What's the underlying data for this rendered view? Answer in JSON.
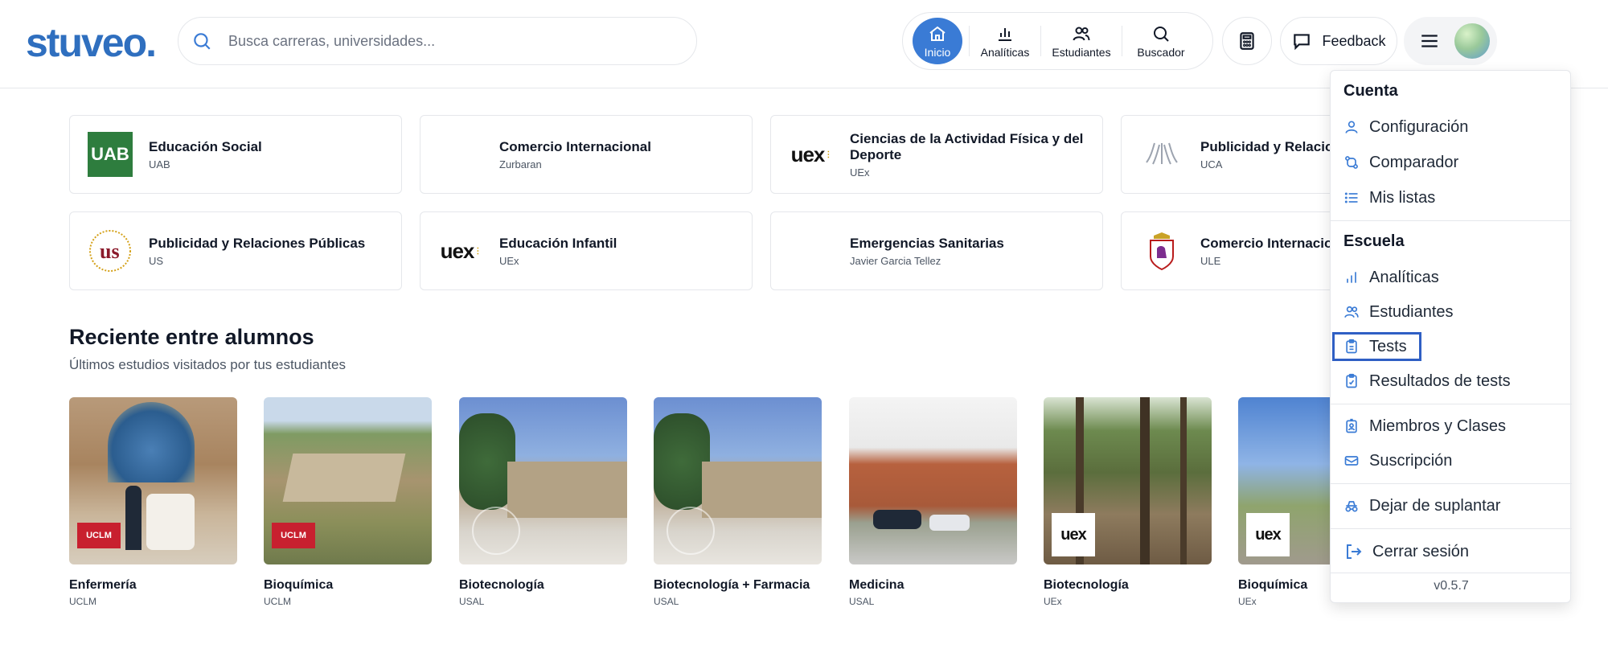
{
  "header": {
    "logo": "stuveo.",
    "search_placeholder": "Busca carreras, universidades...",
    "nav": {
      "inicio": "Inicio",
      "analiticas": "Analíticas",
      "estudiantes": "Estudiantes",
      "buscador": "Buscador"
    },
    "feedback_label": "Feedback"
  },
  "cards": [
    {
      "title": "Educación Social",
      "sub": "UAB",
      "logo": "UAB"
    },
    {
      "title": "Comercio Internacional",
      "sub": "Zurbaran",
      "logo": ""
    },
    {
      "title": "Ciencias de la Actividad Física y del Deporte",
      "sub": "UEx",
      "logo": "uex"
    },
    {
      "title": "Publicidad y Relacio",
      "sub": "UCA",
      "logo": "uca"
    },
    {
      "title": "Publicidad y Relaciones Públicas",
      "sub": "US",
      "logo": "us"
    },
    {
      "title": "Educación Infantil",
      "sub": "UEx",
      "logo": "uex"
    },
    {
      "title": "Emergencias Sanitarias",
      "sub": "Javier Garcia Tellez",
      "logo": ""
    },
    {
      "title": "Comercio Internacio",
      "sub": "ULE",
      "logo": "ule"
    }
  ],
  "section": {
    "title": "Reciente entre alumnos",
    "subtitle": "Últimos estudios visitados por tus estudiantes"
  },
  "tiles": [
    {
      "title": "Enfermería",
      "sub": "UCLM",
      "badge": "UCLM"
    },
    {
      "title": "Bioquímica",
      "sub": "UCLM",
      "badge": "UCLM"
    },
    {
      "title": "Biotecnología",
      "sub": "USAL",
      "badge": ""
    },
    {
      "title": "Biotecnología + Farmacia",
      "sub": "USAL",
      "badge": ""
    },
    {
      "title": "Medicina",
      "sub": "USAL",
      "badge": ""
    },
    {
      "title": "Biotecnología",
      "sub": "UEx",
      "badge": "uex"
    },
    {
      "title": "Bioquímica",
      "sub": "UEx",
      "badge": "uex"
    }
  ],
  "dropdown": {
    "cuenta_heading": "Cuenta",
    "configuracion": "Configuración",
    "comparador": "Comparador",
    "mis_listas": "Mis listas",
    "escuela_heading": "Escuela",
    "analiticas": "Analíticas",
    "estudiantes": "Estudiantes",
    "tests": "Tests",
    "resultados": "Resultados de tests",
    "miembros": "Miembros y Clases",
    "suscripcion": "Suscripción",
    "dejar": "Dejar de suplantar",
    "cerrar": "Cerrar sesión",
    "version": "v0.5.7"
  },
  "colors": {
    "brand": "#2f6fbf",
    "active_nav": "#3a7bd5",
    "highlight": "#2f5fc4"
  }
}
